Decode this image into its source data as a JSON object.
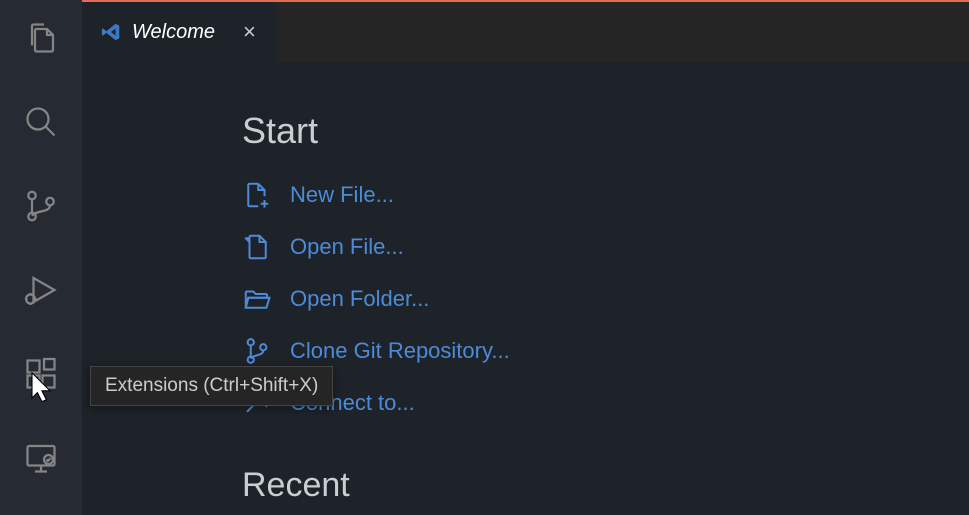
{
  "activity_bar": {
    "items": [
      {
        "name": "explorer"
      },
      {
        "name": "search"
      },
      {
        "name": "source-control"
      },
      {
        "name": "run-debug"
      },
      {
        "name": "extensions"
      },
      {
        "name": "remote"
      }
    ]
  },
  "tooltip": {
    "text": "Extensions (Ctrl+Shift+X)"
  },
  "tabs": [
    {
      "label": "Welcome"
    }
  ],
  "welcome": {
    "start_title": "Start",
    "start_items": [
      {
        "label": "New File...",
        "icon": "new-file"
      },
      {
        "label": "Open File...",
        "icon": "open-file"
      },
      {
        "label": "Open Folder...",
        "icon": "open-folder"
      },
      {
        "label": "Clone Git Repository...",
        "icon": "git-clone"
      },
      {
        "label": "Connect to...",
        "icon": "connect"
      }
    ],
    "recent_title": "Recent"
  },
  "colors": {
    "link": "#4d8bd8",
    "accent_top": "#e06c52"
  }
}
